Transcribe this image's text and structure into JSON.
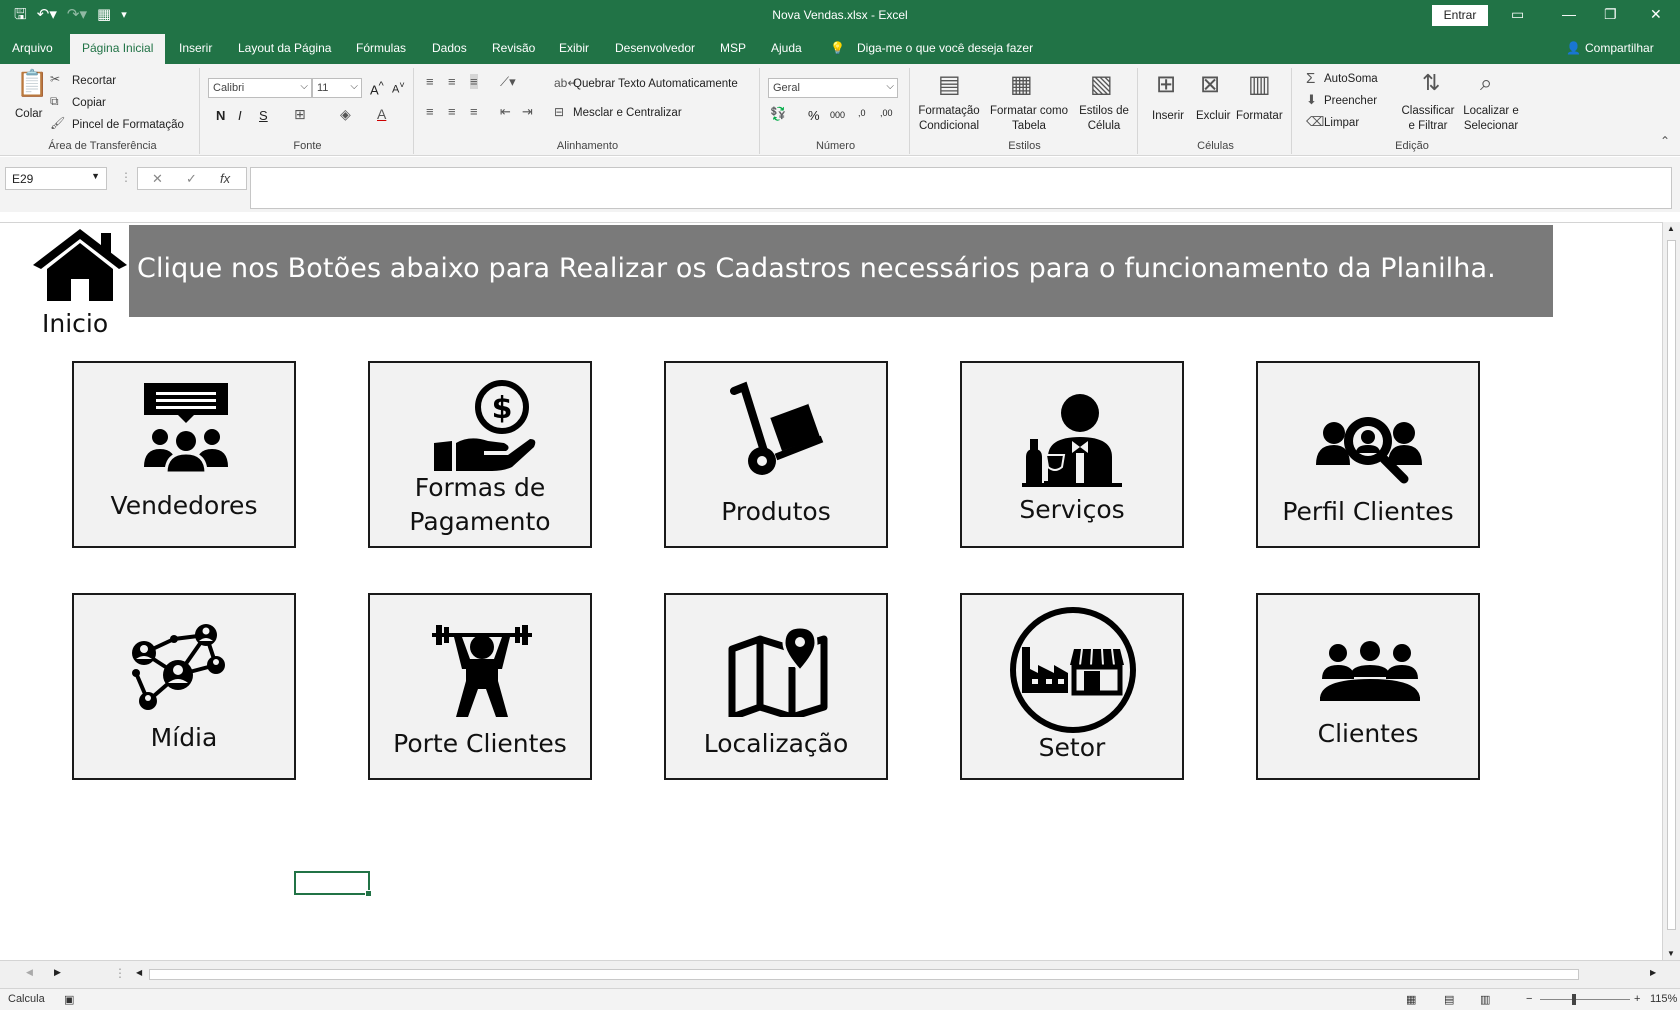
{
  "window": {
    "title": "Nova Vendas.xlsx  -  Excel",
    "signin_label": "Entrar",
    "share_label": "Compartilhar"
  },
  "tabs": [
    "Arquivo",
    "Página Inicial",
    "Inserir",
    "Layout da Página",
    "Fórmulas",
    "Dados",
    "Revisão",
    "Exibir",
    "Desenvolvedor",
    "MSP",
    "Ajuda"
  ],
  "tell_me": "Diga-me o que você deseja fazer",
  "ribbon": {
    "clipboard": {
      "paste": "Colar",
      "cut": "Recortar",
      "copy": "Copiar",
      "format_painter": "Pincel de Formatação",
      "label": "Área de Transferência"
    },
    "font": {
      "name": "Calibri",
      "size": "11",
      "bold": "N",
      "italic": "I",
      "underline": "S",
      "label": "Fonte"
    },
    "alignment": {
      "wrap": "Quebrar Texto Automaticamente",
      "merge": "Mesclar e Centralizar",
      "label": "Alinhamento"
    },
    "number": {
      "format": "Geral",
      "label": "Número"
    },
    "styles": {
      "conditional": "Formatação Condicional",
      "as_table": "Formatar como Tabela",
      "cell_styles": "Estilos de Célula",
      "label": "Estilos"
    },
    "cells": {
      "insert": "Inserir",
      "delete": "Excluir",
      "format": "Formatar",
      "label": "Células"
    },
    "editing": {
      "autosum": "AutoSoma",
      "fill": "Preencher",
      "clear": "Limpar",
      "sort": "Classificar e Filtrar",
      "find": "Localizar e Selecionar",
      "label": "Edição"
    }
  },
  "formula_bar": {
    "name_box": "E29",
    "fx": "fx",
    "value": ""
  },
  "sheet": {
    "banner": "Clique nos Botões abaixo para Realizar os Cadastros necessários para o funcionamento da Planilha.",
    "home_label": "Inicio",
    "buttons": [
      {
        "label": "Vendedores",
        "icon": "people-chat-icon"
      },
      {
        "label": "Formas de Pagamento",
        "icon": "hand-money-icon"
      },
      {
        "label": "Produtos",
        "icon": "hand-truck-icon"
      },
      {
        "label": "Serviços",
        "icon": "waiter-icon"
      },
      {
        "label": "Perfil Clientes",
        "icon": "people-search-icon"
      },
      {
        "label": "Mídia",
        "icon": "network-icon"
      },
      {
        "label": "Porte Clientes",
        "icon": "weightlifter-icon"
      },
      {
        "label": "Localização",
        "icon": "map-pin-icon"
      },
      {
        "label": "Setor",
        "icon": "factory-store-icon"
      },
      {
        "label": "Clientes",
        "icon": "group-icon"
      }
    ]
  },
  "status": {
    "mode": "Calcula",
    "zoom": "115%"
  }
}
